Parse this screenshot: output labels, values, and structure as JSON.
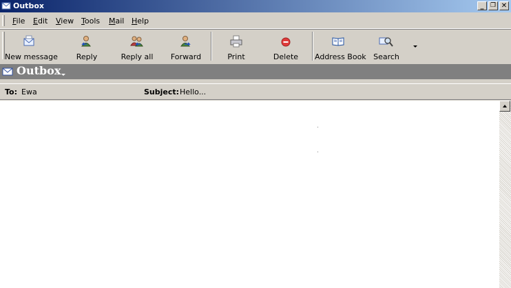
{
  "window": {
    "title": "Outbox",
    "controls": {
      "minimize": "_",
      "restore": "❐",
      "close": "✕"
    }
  },
  "menu": [
    {
      "label": "File",
      "accel": "F",
      "rest": "ile"
    },
    {
      "label": "Edit",
      "accel": "E",
      "rest": "dit"
    },
    {
      "label": "View",
      "accel": "V",
      "rest": "iew"
    },
    {
      "label": "Tools",
      "accel": "T",
      "rest": "ools"
    },
    {
      "label": "Mail",
      "accel": "M",
      "rest": "ail"
    },
    {
      "label": "Help",
      "accel": "H",
      "rest": "elp"
    }
  ],
  "toolbar": {
    "new_message": "New message",
    "reply": "Reply",
    "reply_all": "Reply all",
    "forward": "Forward",
    "print": "Print",
    "delete": "Delete",
    "address_book": "Address Book",
    "search": "Search"
  },
  "folder": {
    "name": "Outbox"
  },
  "message_header": {
    "to_label": "To:",
    "to_value": "Ewa",
    "subject_label": "Subject:",
    "subject_value": "Hello..."
  },
  "colors": {
    "title_gradient_start": "#0a246a",
    "title_gradient_end": "#a6caf0",
    "folder_bar": "#808080",
    "chrome": "#d4d0c8",
    "delete_icon": "#e03c3c"
  }
}
